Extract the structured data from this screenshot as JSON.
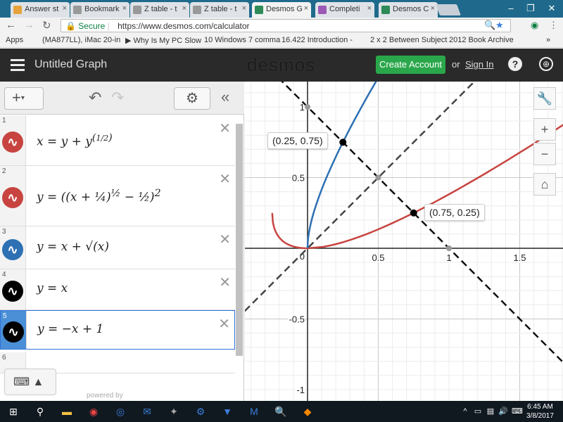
{
  "browser": {
    "tabs": [
      {
        "label": "Answer st",
        "color": "#e6a23c"
      },
      {
        "label": "Bookmark",
        "color": "#999999"
      },
      {
        "label": "Z table - t",
        "color": "#999999"
      },
      {
        "label": "Z table - t",
        "color": "#999999"
      },
      {
        "label": "Desmos G",
        "color": "#2e8b57"
      },
      {
        "label": "Completi",
        "color": "#9b59b6"
      },
      {
        "label": "Desmos C",
        "color": "#2e8b57"
      }
    ],
    "secure_label": "Secure",
    "url": "https://www.desmos.com/calculator",
    "bookmarks": [
      "Apps",
      "(MA877LL), iMac 20-in",
      "▶ Why Is My PC Slow",
      "10 Windows 7 comma",
      "16.422 Introduction -",
      "2 x 2 Between Subject",
      "2012 Book Archive"
    ],
    "more_bookmarks": "»"
  },
  "header": {
    "title": "Untitled Graph",
    "logo": "desmos",
    "create_account": "Create Account",
    "or_text": "or",
    "sign_in": "Sign In"
  },
  "expressions": [
    {
      "num": "1",
      "color": "#c74440",
      "latex_html": "x = y + y<sup>(<span style='font-size:11px'>1/2</span>)</sup>"
    },
    {
      "num": "2",
      "color": "#c74440",
      "latex_html": "y = ((x + ¼)<sup>½</sup> − ½)<sup>2</sup>"
    },
    {
      "num": "3",
      "color": "#2d70b3",
      "latex_html": "y = x + √(x)"
    },
    {
      "num": "4",
      "color": "#000000",
      "latex_html": "y = x"
    },
    {
      "num": "5",
      "color": "#000000",
      "latex_html": "y = −x + 1"
    },
    {
      "num": "6",
      "color": "",
      "latex_html": ""
    }
  ],
  "powered_by": "powered by",
  "graph": {
    "x_ticks": [
      "0.5",
      "1",
      "1.5"
    ],
    "y_ticks": [
      "1",
      "0.5",
      "-0.5",
      "-1"
    ],
    "origin_label": "0",
    "point_labels": [
      "(0.25, 0.75)",
      "(0.75, 0.25)"
    ],
    "red": "#c74440",
    "blue": "#2d70b3"
  },
  "clock": {
    "time": "6:45 AM",
    "date": "3/8/2017"
  }
}
